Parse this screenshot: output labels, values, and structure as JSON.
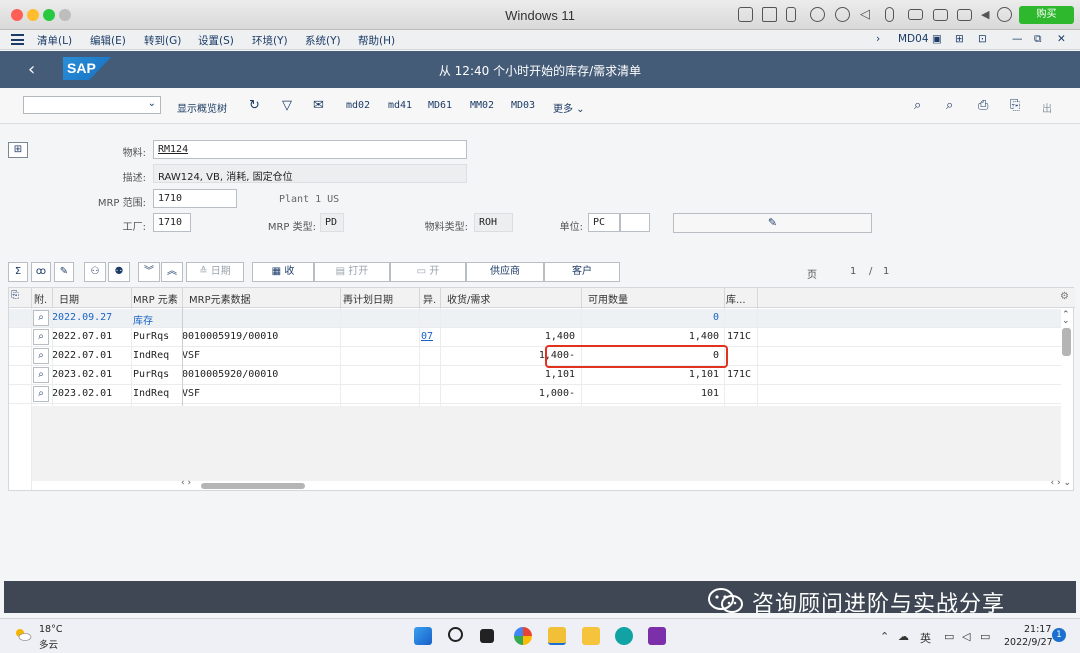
{
  "window": {
    "title": "Windows 11",
    "buy_label": "购买"
  },
  "menu": {
    "items": [
      "清单(L)",
      "编辑(E)",
      "转到(G)",
      "设置(S)",
      "环境(Y)",
      "系统(Y)",
      "帮助(H)"
    ],
    "tcode": "MD04"
  },
  "shell": {
    "title": "从 12:40 个小时开始的库存/需求清单"
  },
  "toolbar": {
    "variant_value": "",
    "items": [
      "显示概览树",
      "md02",
      "md41",
      "MD61",
      "MM02",
      "MD03",
      "更多"
    ],
    "exit_label": "出"
  },
  "form": {
    "material_label": "物料:",
    "material_value": "RM124",
    "desc_label": "描述:",
    "desc_value": "RAW124, VB, 消耗, 固定仓位",
    "mrp_area_label": "MRP 范围:",
    "mrp_area_value": "1710",
    "mrp_area_text": "Plant 1 US",
    "plant_label": "工厂:",
    "plant_value": "1710",
    "mrp_type_label": "MRP 类型:",
    "mrp_type_value": "PD",
    "mat_type_label": "物料类型:",
    "mat_type_value": "ROH",
    "unit_label": "单位:",
    "unit_value": "PC",
    "unit_extra": ""
  },
  "grid_toolbar": {
    "date_label": "日期",
    "receipt_label": "收",
    "open_label": "打开",
    "open2_label": "开",
    "vendor_label": "供应商",
    "customer_label": "客户",
    "page_label": "页",
    "page_current": "1",
    "page_sep": "/",
    "page_total": "1"
  },
  "grid": {
    "columns": [
      "附.",
      "日期",
      "MRP 元素",
      "MRP元素数据",
      "再计划日期",
      "异.",
      "收货/需求",
      "可用数量",
      "库..."
    ],
    "rows": [
      {
        "date": "2022.09.27",
        "element": "库存",
        "data": "",
        "resched": "",
        "exc": "",
        "qty": "",
        "avail": "0",
        "storage": "",
        "link": true
      },
      {
        "date": "2022.07.01",
        "element": "PurRqs",
        "data": "0010005919/00010",
        "resched": "",
        "exc": "07",
        "qty": "1,400",
        "avail": "1,400",
        "storage": "171C",
        "link": false
      },
      {
        "date": "2022.07.01",
        "element": "IndReq",
        "data": "VSF",
        "resched": "",
        "exc": "",
        "qty": "1,400-",
        "avail": "0",
        "storage": "",
        "link": false
      },
      {
        "date": "2023.02.01",
        "element": "PurRqs",
        "data": "0010005920/00010",
        "resched": "",
        "exc": "",
        "qty": "1,101",
        "avail": "1,101",
        "storage": "171C",
        "link": false
      },
      {
        "date": "2023.02.01",
        "element": "IndReq",
        "data": "VSF",
        "resched": "",
        "exc": "",
        "qty": "1,000-",
        "avail": "101",
        "storage": "",
        "link": false
      }
    ]
  },
  "watermark": {
    "text": "咨询顾问进阶与实战分享"
  },
  "taskbar": {
    "weather_temp": "18°C",
    "weather_desc": "多云",
    "time": "21:17",
    "date": "2022/9/27",
    "notif_count": "1"
  },
  "colors": {
    "shell": "#455c79",
    "sap_blue": "#1670c2",
    "link": "#1a63c5",
    "highlight": "#e0321e",
    "buy": "#2eb82e"
  }
}
